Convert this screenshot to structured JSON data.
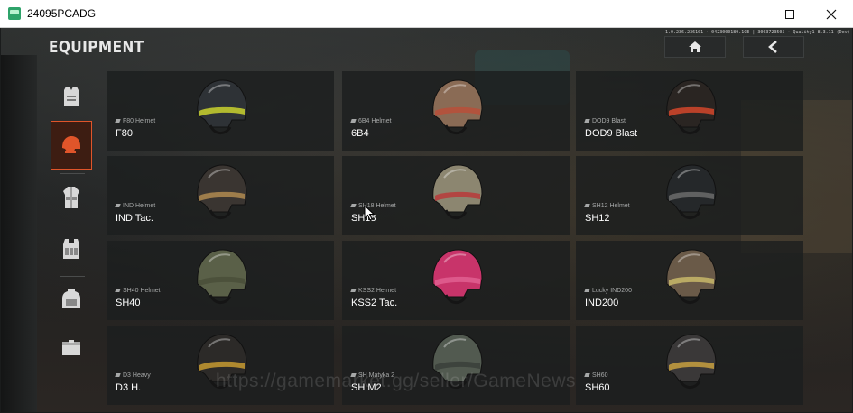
{
  "window": {
    "title": "24095PCADG"
  },
  "header": {
    "title": "EQUIPMENT",
    "version": "1.0.236.236101 · 0423000189.1CE | 3003723505 · Quality1 8.3.11 (Dev)",
    "home_icon": "home-icon",
    "back_icon": "chevron-left-icon"
  },
  "sidebar": {
    "items": [
      {
        "name": "vest",
        "icon": "vest-icon",
        "active": false
      },
      {
        "name": "helmet",
        "icon": "helmet-icon",
        "active": true
      },
      {
        "name": "outfit",
        "icon": "outfit-icon",
        "active": false
      },
      {
        "name": "rig",
        "icon": "rig-icon",
        "active": false
      },
      {
        "name": "backpack",
        "icon": "backpack-icon",
        "active": false
      },
      {
        "name": "pouch",
        "icon": "pouch-icon",
        "active": false
      }
    ]
  },
  "accent_color": "#e0552a",
  "helmets": [
    {
      "type": "F80 Helmet",
      "name": "F80",
      "color": "#2e3236",
      "accent": "#c9d22e"
    },
    {
      "type": "6B4 Helmet",
      "name": "6B4",
      "color": "#8a6b55",
      "accent": "#b84f3a"
    },
    {
      "type": "DOD9 Blast",
      "name": "DOD9 Blast",
      "color": "#2a2522",
      "accent": "#d4462a"
    },
    {
      "type": "IND Helmet",
      "name": "IND Tac.",
      "color": "#3a3531",
      "accent": "#b08a50"
    },
    {
      "type": "SH18 Helmet",
      "name": "SH18",
      "color": "#8c8670",
      "accent": "#b83a3a"
    },
    {
      "type": "SH12 Helmet",
      "name": "SH12",
      "color": "#25282a",
      "accent": "#6b6b6b"
    },
    {
      "type": "SH40 Helmet",
      "name": "SH40",
      "color": "#5a6048",
      "accent": "#4a4f3a"
    },
    {
      "type": "KSS2 Helmet",
      "name": "KSS2 Tac.",
      "color": "#c8346a",
      "accent": "#e06090"
    },
    {
      "type": "Lucky IND200",
      "name": "IND200",
      "color": "#6a5a48",
      "accent": "#c8b86a"
    },
    {
      "type": "D3 Heavy",
      "name": "D3 H.",
      "color": "#2c2a28",
      "accent": "#c79a30"
    },
    {
      "type": "SH Matyka 2",
      "name": "SH M2",
      "color": "#525a50",
      "accent": "#3a3f3a"
    },
    {
      "type": "SH60",
      "name": "SH60",
      "color": "#3a3838",
      "accent": "#c8a040"
    }
  ],
  "watermark": "https://gamemarket.gg/seller/GameNews"
}
